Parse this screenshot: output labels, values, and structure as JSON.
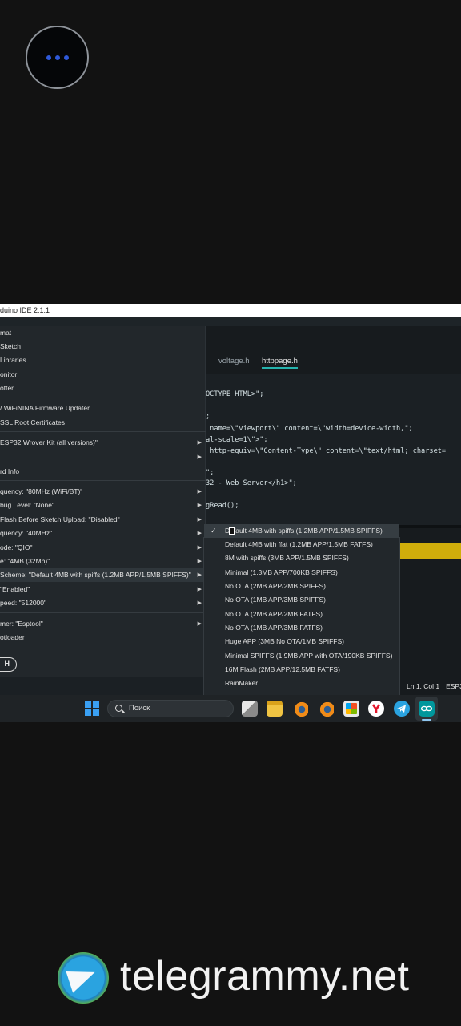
{
  "app": {
    "title": "duino IDE 2.1.1"
  },
  "tabs": [
    {
      "label": "voltage.h",
      "active": false
    },
    {
      "label": "httppage.h",
      "active": true
    }
  ],
  "code_lines": [
    "OCTYPE HTML>\";",
    ";",
    " name=\\\"viewport\\\" content=\\\"width=device-width,\";",
    "al-scale=1\\\">\";",
    " http-equiv=\\\"Content-Type\\\" content=\\\"text/html; charset=",
    "\";",
    "32 - Web Server</h1>\";",
    "gRead();"
  ],
  "tools_menu": {
    "items": [
      {
        "label": "mat",
        "submenu": false
      },
      {
        "label": "Sketch",
        "submenu": false
      },
      {
        "label": "Libraries...",
        "submenu": false
      },
      {
        "label": "onitor",
        "submenu": false
      },
      {
        "label": "otter",
        "submenu": false
      },
      {
        "label": "/ WiFiNINA Firmware Updater",
        "submenu": false
      },
      {
        "label": "SSL Root Certificates",
        "submenu": false
      },
      {
        "label": "ESP32 Wrover Kit (all versions)\"",
        "submenu": true
      },
      {
        "label": "",
        "submenu": true
      },
      {
        "label": "rd Info",
        "submenu": false
      },
      {
        "label": "quency: \"80MHz (WiFi/BT)\"",
        "submenu": true
      },
      {
        "label": "bug Level: \"None\"",
        "submenu": true
      },
      {
        "label": " Flash Before Sketch Upload: \"Disabled\"",
        "submenu": true
      },
      {
        "label": "quency: \"40MHz\"",
        "submenu": true
      },
      {
        "label": "ode: \"QIO\"",
        "submenu": true
      },
      {
        "label": "e: \"4MB (32Mb)\"",
        "submenu": true
      },
      {
        "label": " Scheme: \"Default 4MB with spiffs (1.2MB APP/1.5MB SPIFFS)\"",
        "submenu": true
      },
      {
        "label": "\"Enabled\"",
        "submenu": true
      },
      {
        "label": "peed: \"512000\"",
        "submenu": true
      },
      {
        "label": "mer: \"Esptool\"",
        "submenu": true
      },
      {
        "label": "otloader",
        "submenu": false
      }
    ],
    "button_label": "H"
  },
  "partition_submenu": {
    "items": [
      {
        "label": "Default 4MB with spiffs (1.2MB APP/1.5MB SPIFFS)",
        "checked": true
      },
      {
        "label": "Default 4MB with ffat (1.2MB APP/1.5MB FATFS)",
        "checked": false
      },
      {
        "label": "8M with spiffs (3MB APP/1.5MB SPIFFS)",
        "checked": false
      },
      {
        "label": "Minimal (1.3MB APP/700KB SPIFFS)",
        "checked": false
      },
      {
        "label": "No OTA (2MB APP/2MB SPIFFS)",
        "checked": false
      },
      {
        "label": "No OTA (1MB APP/3MB SPIFFS)",
        "checked": false
      },
      {
        "label": "No OTA (2MB APP/2MB FATFS)",
        "checked": false
      },
      {
        "label": "No OTA (1MB APP/3MB FATFS)",
        "checked": false
      },
      {
        "label": "Huge APP (3MB No OTA/1MB SPIFFS)",
        "checked": false
      },
      {
        "label": "Minimal SPIFFS (1.9MB APP with OTA/190KB SPIFFS)",
        "checked": false
      },
      {
        "label": "16M Flash (2MB APP/12.5MB FATFS)",
        "checked": false
      },
      {
        "label": "RainMaker",
        "checked": false
      }
    ],
    "check_glyph": "✓"
  },
  "status_bar": {
    "position": "Ln 1, Col 1",
    "board": "ESP3"
  },
  "taskbar": {
    "search_label": "Поиск",
    "icons": [
      "windows-start-icon",
      "task-view-icon",
      "file-explorer-icon",
      "blender-icon",
      "blender-icon",
      "microsoft-store-icon",
      "yandex-browser-icon",
      "telegram-icon",
      "arduino-ide-icon"
    ]
  },
  "watermark": {
    "text": "telegrammy.net"
  },
  "colors": {
    "accent_teal": "#26b3ad",
    "highlight_yellow": "#d1ae0b",
    "windows_blue": "#3aa0f3"
  }
}
